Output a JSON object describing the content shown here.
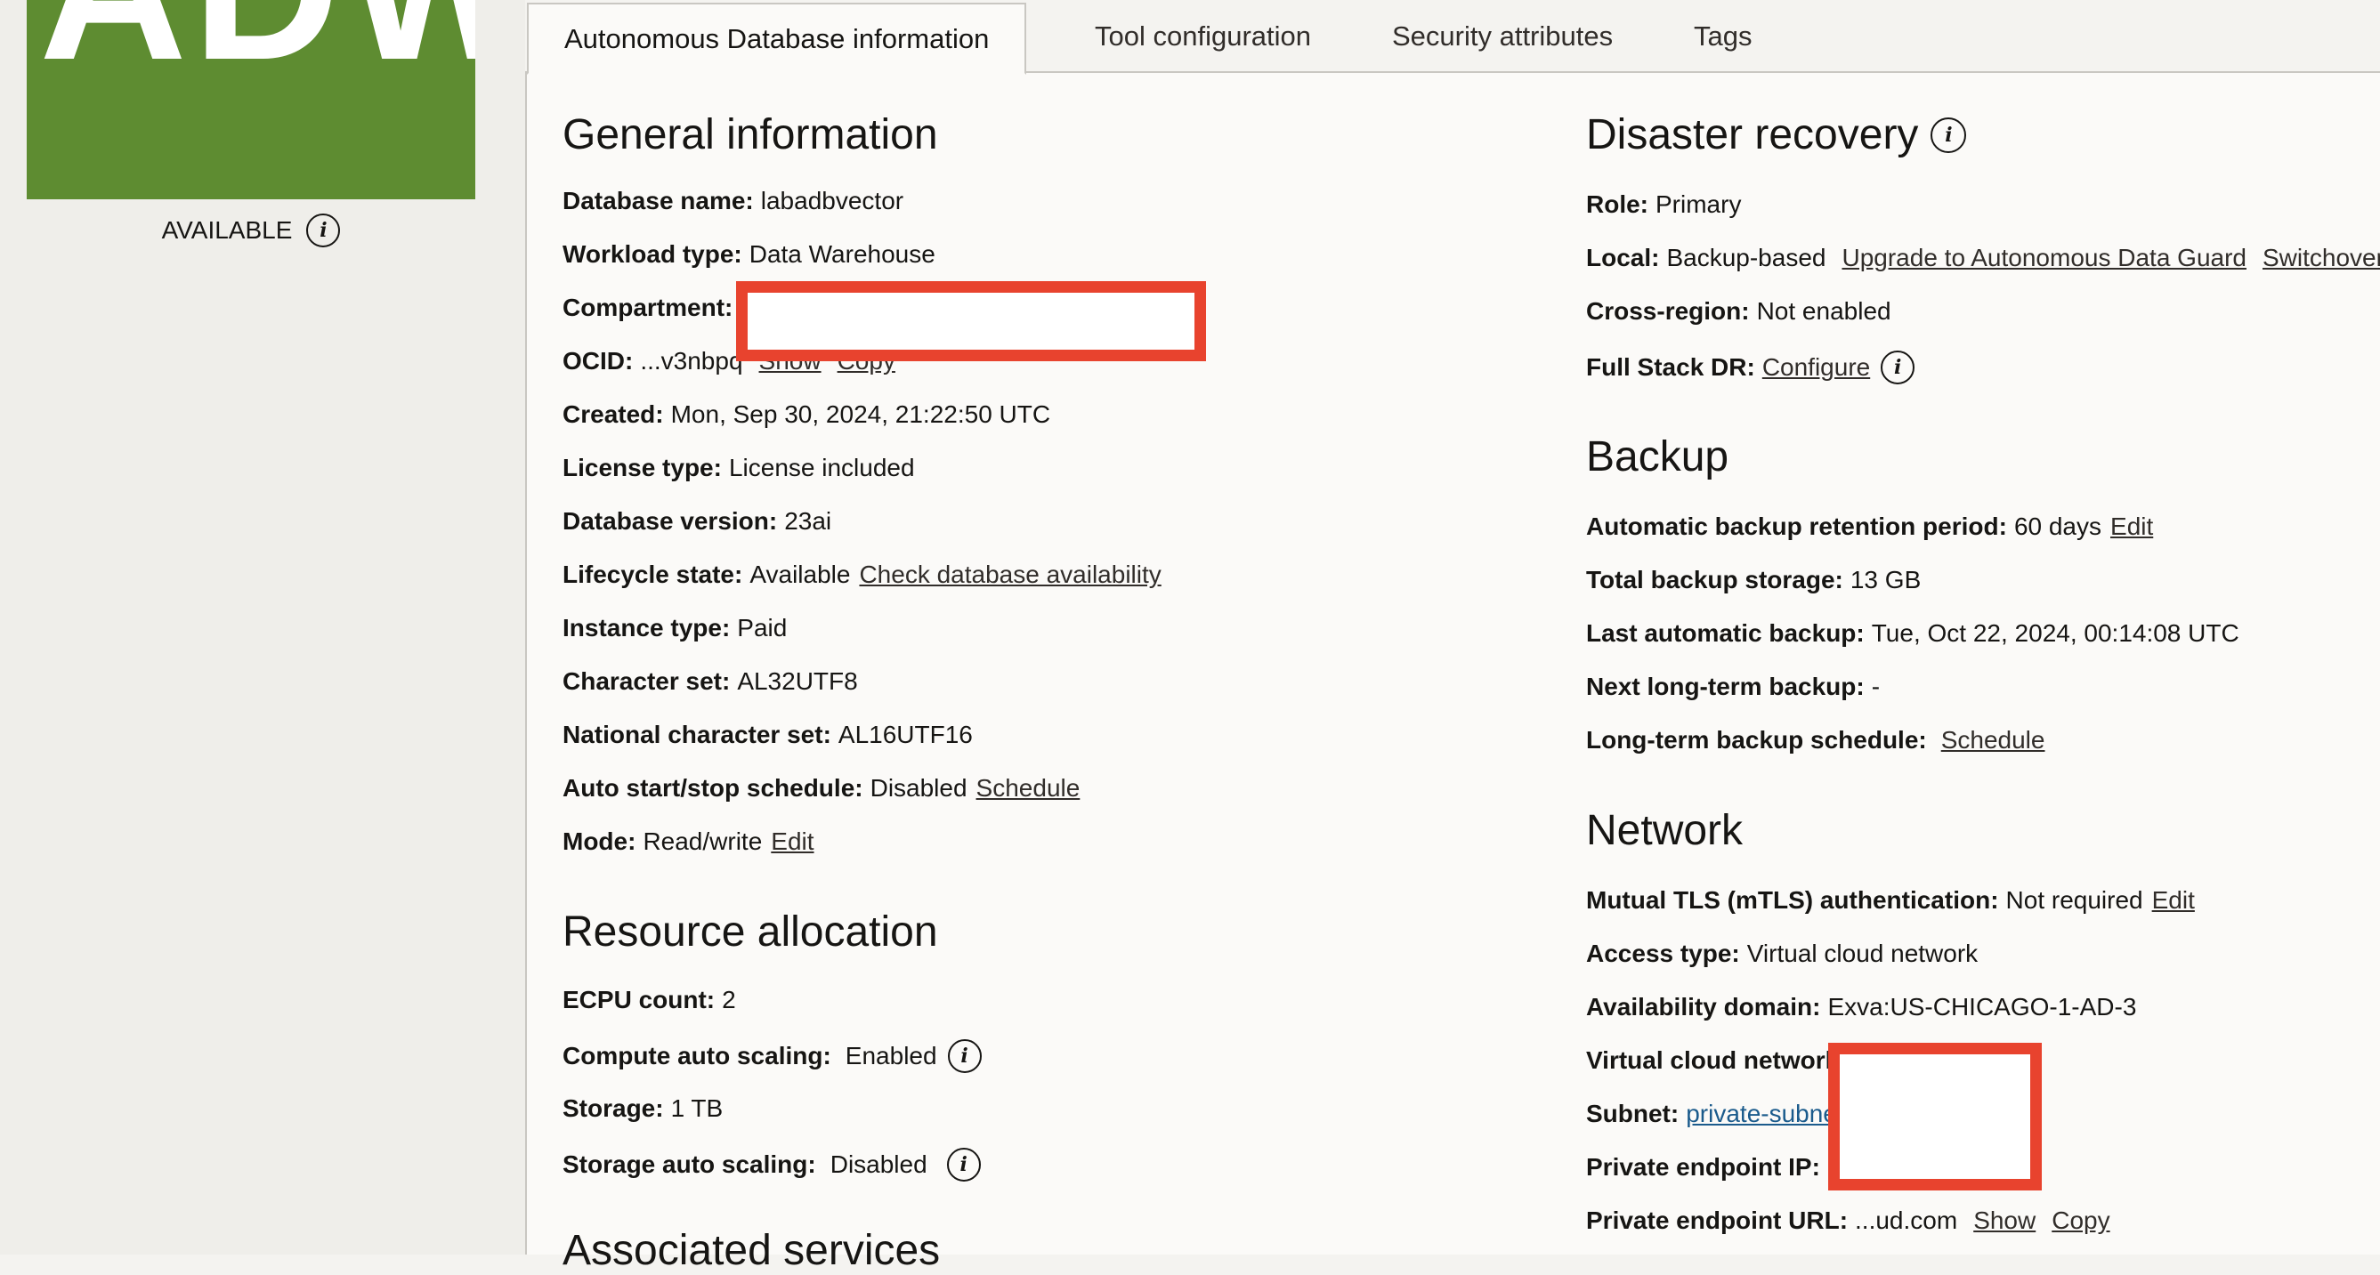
{
  "sidebar": {
    "tile_text": "ADW",
    "tile_color": "#5e8c31",
    "status_label": "AVAILABLE",
    "status_info_icon": "i"
  },
  "tabs": [
    {
      "label": "Autonomous Database information",
      "active": true
    },
    {
      "label": "Tool configuration",
      "active": false
    },
    {
      "label": "Security attributes",
      "active": false
    },
    {
      "label": "Tags",
      "active": false
    }
  ],
  "general": {
    "title": "General information",
    "database_name": {
      "label": "Database name:",
      "value": "labadbvector"
    },
    "workload_type": {
      "label": "Workload type:",
      "value": "Data Warehouse"
    },
    "compartment": {
      "label": "Compartment:",
      "value": ""
    },
    "ocid": {
      "label": "OCID:",
      "value": "...v3nbpq",
      "show": "Show",
      "copy": "Copy"
    },
    "created": {
      "label": "Created:",
      "value": "Mon, Sep 30, 2024, 21:22:50 UTC"
    },
    "license_type": {
      "label": "License type:",
      "value": "License included"
    },
    "database_version": {
      "label": "Database version:",
      "value": "23ai"
    },
    "lifecycle_state": {
      "label": "Lifecycle state:",
      "value": "Available",
      "link": "Check database availability"
    },
    "instance_type": {
      "label": "Instance type:",
      "value": "Paid"
    },
    "character_set": {
      "label": "Character set:",
      "value": "AL32UTF8"
    },
    "national_character_set": {
      "label": "National character set:",
      "value": "AL16UTF16"
    },
    "auto_start_stop": {
      "label": "Auto start/stop schedule:",
      "value": "Disabled",
      "link": "Schedule"
    },
    "mode": {
      "label": "Mode:",
      "value": "Read/write",
      "link": "Edit"
    }
  },
  "resource": {
    "title": "Resource allocation",
    "ecpu_count": {
      "label": "ECPU count:",
      "value": "2"
    },
    "compute_auto_scaling": {
      "label": "Compute auto scaling:",
      "value": "Enabled"
    },
    "storage": {
      "label": "Storage:",
      "value": "1 TB"
    },
    "storage_auto_scaling": {
      "label": "Storage auto scaling:",
      "value": "Disabled"
    }
  },
  "associated": {
    "title": "Associated services"
  },
  "disaster_recovery": {
    "title": "Disaster recovery",
    "role": {
      "label": "Role:",
      "value": "Primary"
    },
    "local": {
      "label": "Local:",
      "value": "Backup-based",
      "link1": "Upgrade to Autonomous Data Guard",
      "link2": "Switchover"
    },
    "cross_region": {
      "label": "Cross-region:",
      "value": "Not enabled"
    },
    "full_stack_dr": {
      "label": "Full Stack DR:",
      "link": "Configure"
    }
  },
  "backup": {
    "title": "Backup",
    "retention": {
      "label": "Automatic backup retention period:",
      "value": "60 days",
      "link": "Edit"
    },
    "total_storage": {
      "label": "Total backup storage:",
      "value": "13 GB"
    },
    "last_backup": {
      "label": "Last automatic backup:",
      "value": "Tue, Oct 22, 2024, 00:14:08 UTC"
    },
    "next_long_term": {
      "label": "Next long-term backup:",
      "value": "-"
    },
    "long_term_schedule": {
      "label": "Long-term backup schedule:",
      "link": "Schedule"
    }
  },
  "network": {
    "title": "Network",
    "mtls": {
      "label": "Mutual TLS (mTLS) authentication:",
      "value": "Not required",
      "link": "Edit"
    },
    "access_type": {
      "label": "Access type:",
      "value": "Virtual cloud network"
    },
    "availability_domain": {
      "label": "Availability domain:",
      "value": "Exva:US-CHICAGO-1-AD-3"
    },
    "vcn": {
      "label": "Virtual cloud network:"
    },
    "subnet": {
      "label": "Subnet:",
      "link": "private-subnet"
    },
    "private_ip": {
      "label": "Private endpoint IP:"
    },
    "private_url": {
      "label": "Private endpoint URL:",
      "value": "...ud.com",
      "show": "Show",
      "copy": "Copy"
    }
  },
  "colors": {
    "redaction": "#e8432e",
    "link_blue": "#1b5b8c"
  }
}
